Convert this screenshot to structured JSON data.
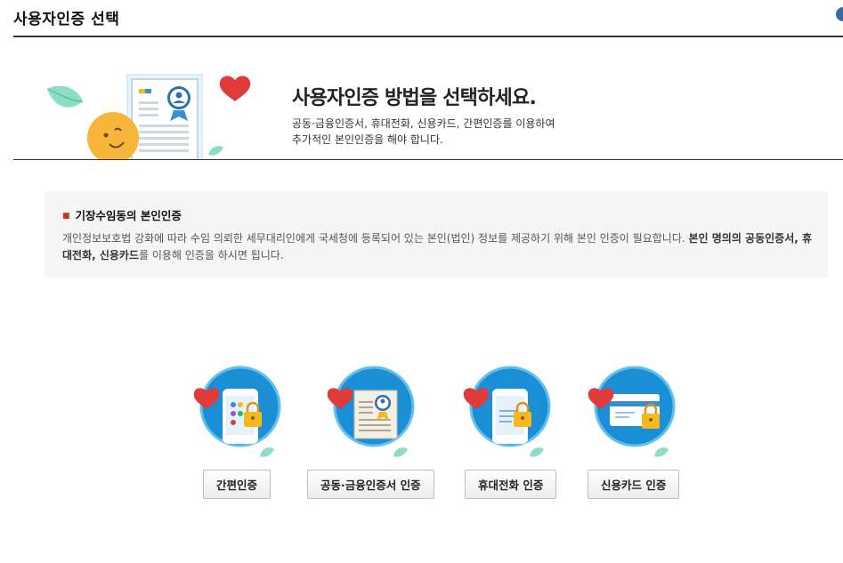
{
  "page_title": "사용자인증 선택",
  "hero": {
    "heading": "사용자인증 방법을 선택하세요.",
    "desc_line1": "공동·금융인증서, 휴대전화, 신용카드, 간편인증를 이용하여",
    "desc_line2": "추가적인 본인인증을 해야 합니다."
  },
  "notice": {
    "title": "기장수임동의 본인인증",
    "body_normal_1": "개인정보보호법 강화에 따라 수임 의뢰한 세무대리인에게 국세청에 등록되어 있는 본인(법인) 정보를 제공하기 위해 본인 인증이 필요합니다. ",
    "body_bold": "본인 명의의 공동인증서, 휴대전화, 신용카드",
    "body_normal_2": "를 이용해 인증을 하시면 됩니다."
  },
  "methods": [
    {
      "label": "간편인증",
      "icon": "simple-auth-icon"
    },
    {
      "label": "공동·금융인증서 인증",
      "icon": "certificate-icon"
    },
    {
      "label": "휴대전화 인증",
      "icon": "mobile-phone-icon"
    },
    {
      "label": "신용카드 인증",
      "icon": "credit-card-icon"
    }
  ],
  "colors": {
    "circle_blue": "#1a8fd6",
    "heart_red": "#e03a3a",
    "lock_yellow": "#f5b81e",
    "leaf_green": "#6fcfb3"
  }
}
